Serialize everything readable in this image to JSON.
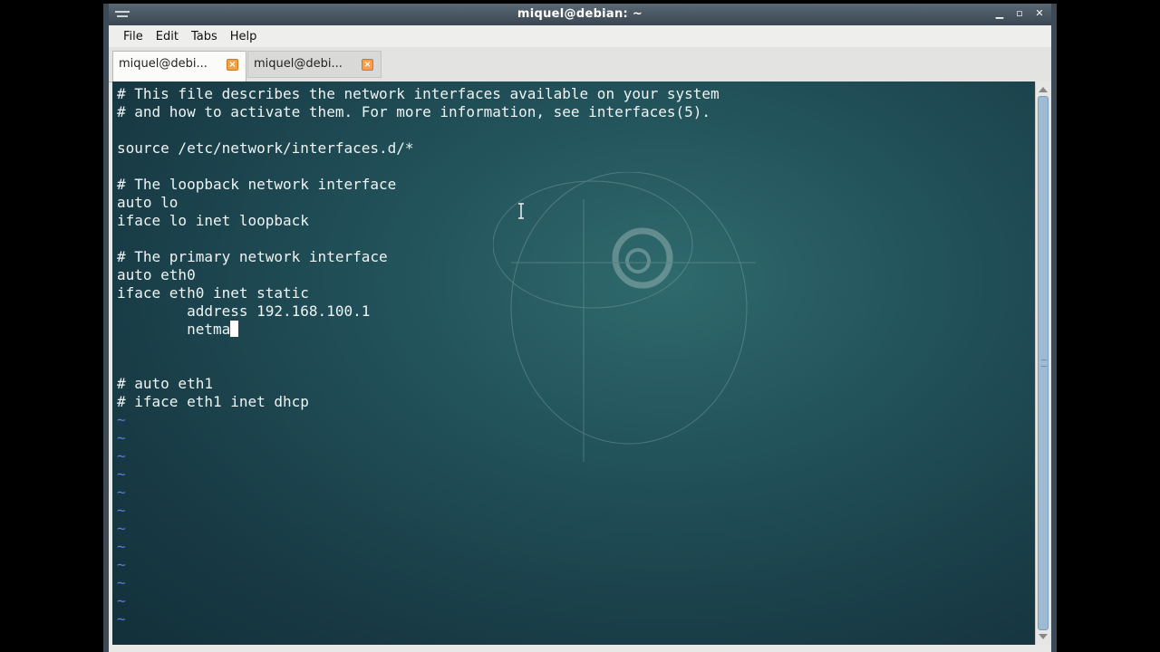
{
  "window": {
    "title": "miquel@debian: ~",
    "controls": {
      "minimize": "▁",
      "maximize": "▫",
      "close": "✕"
    }
  },
  "menu": {
    "items": [
      "File",
      "Edit",
      "Tabs",
      "Help"
    ]
  },
  "tabs": [
    {
      "label": "miquel@debi...",
      "active": true,
      "close_icon": "close-icon"
    },
    {
      "label": "miquel@debi...",
      "active": false,
      "close_icon": "close-icon"
    }
  ],
  "terminal": {
    "lines": [
      "# This file describes the network interfaces available on your system",
      "# and how to activate them. For more information, see interfaces(5).",
      "",
      "source /etc/network/interfaces.d/*",
      "",
      "# The loopback network interface",
      "auto lo",
      "iface lo inet loopback",
      "",
      "# The primary network interface",
      "auto eth0",
      "iface eth0 inet static",
      "        address 192.168.100.1",
      "        netma",
      "",
      "",
      "# auto eth1",
      "# iface eth1 inet dhcp"
    ],
    "tilde_glyph": "~",
    "tilde_lines": 12,
    "cursor_line": 13,
    "background_colors": [
      "#2f6a6d",
      "#183a45"
    ],
    "tilde_color": "#5a7de0"
  }
}
